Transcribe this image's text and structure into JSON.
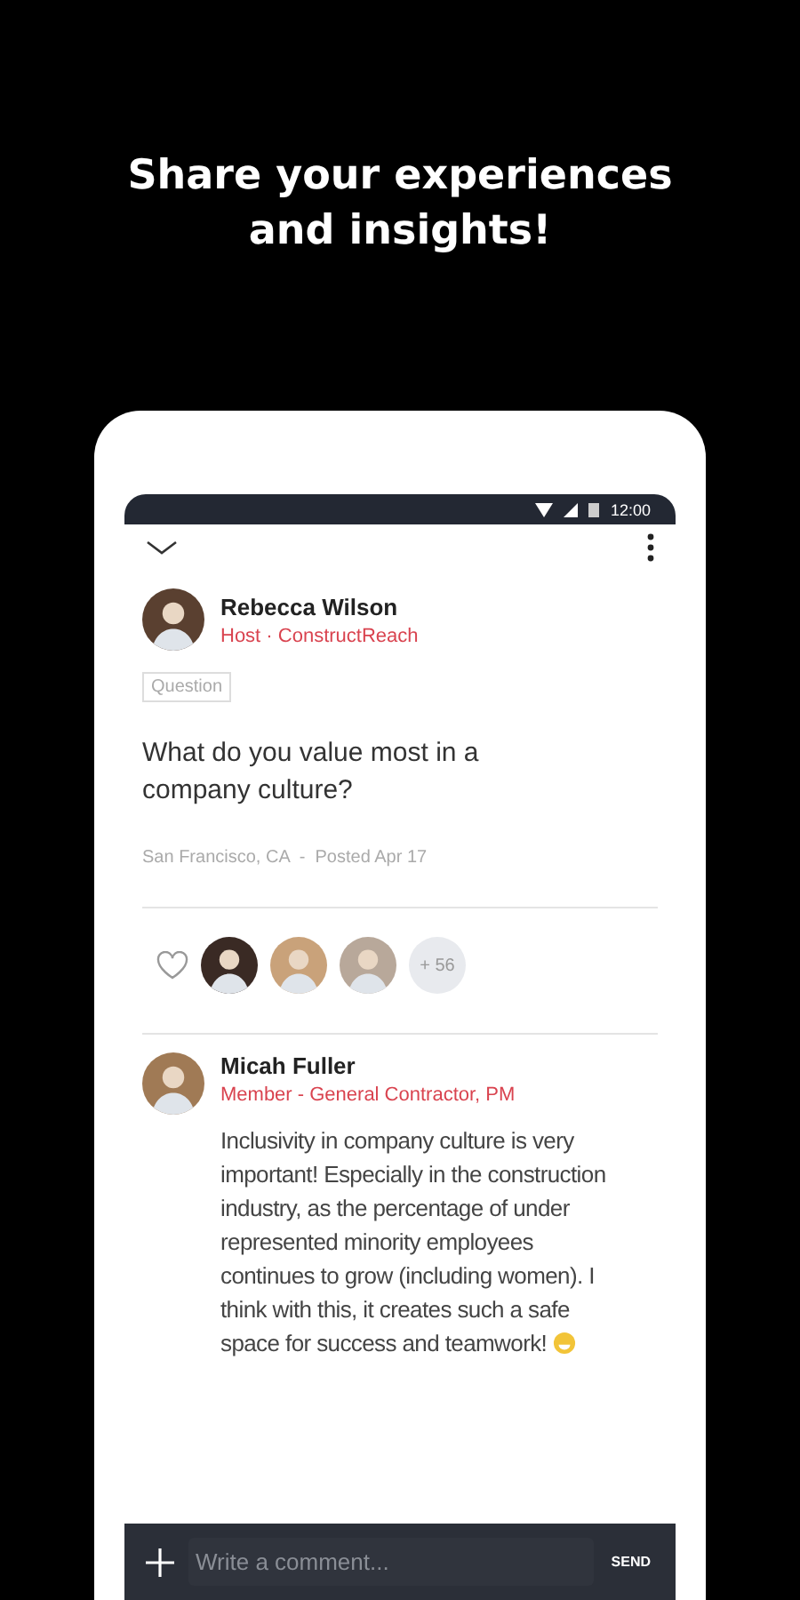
{
  "headline": "Share your experiences and insights!",
  "status_bar": {
    "time": "12:00"
  },
  "post": {
    "author": "Rebecca Wilson",
    "role": "Host · ConstructReach",
    "tag": "Question",
    "question": "What do you value most in a company culture?",
    "meta": "San Francisco, CA  -  Posted Apr 17"
  },
  "reactions": {
    "liked": false,
    "avatars": [
      {
        "color": "#3a2a24"
      },
      {
        "color": "#c9a27a"
      },
      {
        "color": "#b8a89a"
      }
    ],
    "more": "+ 56"
  },
  "comment": {
    "author": "Micah Fuller",
    "role": "Member - General Contractor, PM",
    "text": "Inclusivity in company culture is very important! Especially in the construction industry, as the percentage of under represented minority employees continues to grow (including women). I think with this, it creates such a safe space for success and teamwork!"
  },
  "composer": {
    "placeholder": "Write a comment...",
    "send": "SEND"
  }
}
